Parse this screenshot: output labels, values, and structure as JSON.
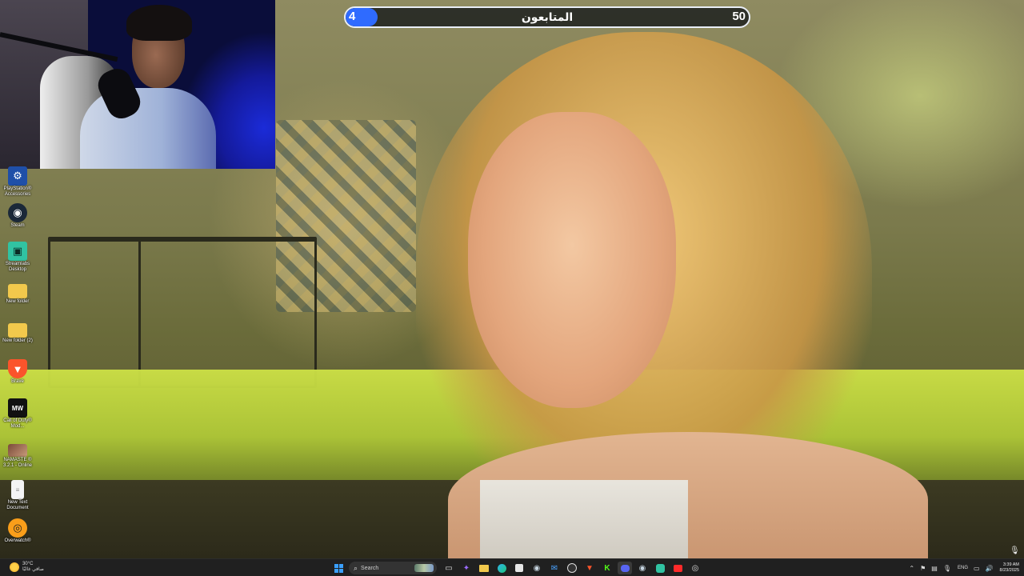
{
  "follower_goal": {
    "label": "المتابعون",
    "current": "4",
    "goal": "50",
    "progress": 0.08,
    "fill_color": "#2f6bff"
  },
  "desktop_icons": [
    {
      "label": "PlayStation® Accessories",
      "icon": "playstation-accessories-icon",
      "color": "#1f4fa8"
    },
    {
      "label": "Steam",
      "icon": "steam-icon",
      "color": "#1b2838"
    },
    {
      "label": "Streamlabs Desktop",
      "icon": "streamlabs-icon",
      "color": "#31c3a2"
    },
    {
      "label": "New folder",
      "icon": "folder-icon",
      "color": "#f2c94c"
    },
    {
      "label": "New folder (2)",
      "icon": "folder-icon",
      "color": "#f2c94c"
    },
    {
      "label": "Brave",
      "icon": "brave-icon",
      "color": "#fb542b"
    },
    {
      "label": "Call of Duty® Mod...",
      "icon": "call-of-duty-icon",
      "color": "#111111"
    },
    {
      "label": "NAMASTE ® 3.2.1 - Online",
      "icon": "namaste-icon",
      "color": "#7a4a3a"
    },
    {
      "label": "New Text Document",
      "icon": "text-document-icon",
      "color": "#f4f4f4"
    },
    {
      "label": "Overwatch®",
      "icon": "overwatch-icon",
      "color": "#f99e1a"
    }
  ],
  "taskbar": {
    "weather_temp": "30°C",
    "weather_desc": "صافي غالبًا",
    "search_placeholder": "Search",
    "apps": [
      {
        "name": "start-button",
        "icon": "windows-icon",
        "color": "#3aa0ff"
      },
      {
        "name": "task-view",
        "icon": "task-view-icon",
        "color": "#dddddd"
      },
      {
        "name": "copilot",
        "icon": "copilot-icon",
        "color": "#9b6bff"
      },
      {
        "name": "file-explorer",
        "icon": "folder-icon",
        "color": "#f2c94c"
      },
      {
        "name": "edge",
        "icon": "edge-icon",
        "color": "#2fb5e8"
      },
      {
        "name": "store",
        "icon": "store-icon",
        "color": "#e6e6e6"
      },
      {
        "name": "steam",
        "icon": "steam-icon",
        "color": "#c7d5e0"
      },
      {
        "name": "mail",
        "icon": "mail-icon",
        "color": "#4aa3ff"
      },
      {
        "name": "obs",
        "icon": "obs-icon",
        "color": "#dddddd"
      },
      {
        "name": "brave",
        "icon": "brave-icon",
        "color": "#fb542b"
      },
      {
        "name": "kick",
        "icon": "kick-icon",
        "color": "#53fc18"
      },
      {
        "name": "discord",
        "icon": "discord-icon",
        "color": "#5865f2"
      },
      {
        "name": "steam-2",
        "icon": "steam-icon",
        "color": "#c7d5e0"
      },
      {
        "name": "streamlabs",
        "icon": "streamlabs-icon",
        "color": "#31c3a2"
      },
      {
        "name": "youtube",
        "icon": "youtube-icon",
        "color": "#ff2a2a"
      },
      {
        "name": "overwatch",
        "icon": "overwatch-icon",
        "color": "#dddddd"
      }
    ],
    "language": "ENG",
    "time": "3:39 AM",
    "date": "8/23/2025"
  }
}
